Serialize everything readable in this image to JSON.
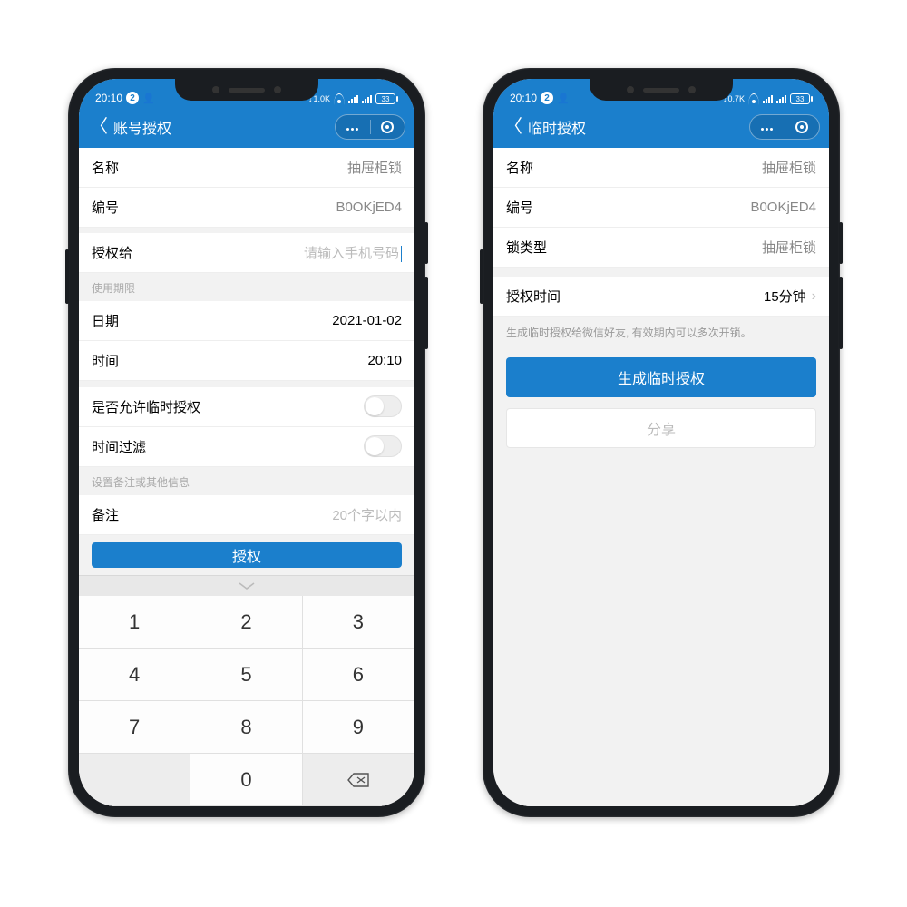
{
  "status": {
    "time": "20:10",
    "badge": "2",
    "net_left": "1.0K",
    "net_right": "0.7K",
    "battery": "33"
  },
  "left": {
    "title": "账号授权",
    "rows": {
      "name_label": "名称",
      "name_value": "抽屉柜锁",
      "id_label": "编号",
      "id_value": "B0OKjED4",
      "auth_to_label": "授权给",
      "auth_to_placeholder": "请输入手机号码",
      "period_section": "使用期限",
      "date_label": "日期",
      "date_value": "2021-01-02",
      "time_label": "时间",
      "time_value": "20:10",
      "allow_temp_label": "是否允许临时授权",
      "time_filter_label": "时间过滤",
      "remark_section": "设置备注或其他信息",
      "remark_label": "备注",
      "remark_placeholder": "20个字以内"
    },
    "button": "授权",
    "keys": [
      "1",
      "2",
      "3",
      "4",
      "5",
      "6",
      "7",
      "8",
      "9",
      "",
      "0",
      ""
    ]
  },
  "right": {
    "title": "临时授权",
    "rows": {
      "name_label": "名称",
      "name_value": "抽屉柜锁",
      "id_label": "编号",
      "id_value": "B0OKjED4",
      "lock_type_label": "锁类型",
      "lock_type_value": "抽屉柜锁",
      "auth_time_label": "授权时间",
      "auth_time_value": "15分钟"
    },
    "hint": "生成临时授权给微信好友, 有效期内可以多次开锁。",
    "button_primary": "生成临时授权",
    "button_secondary": "分享"
  }
}
